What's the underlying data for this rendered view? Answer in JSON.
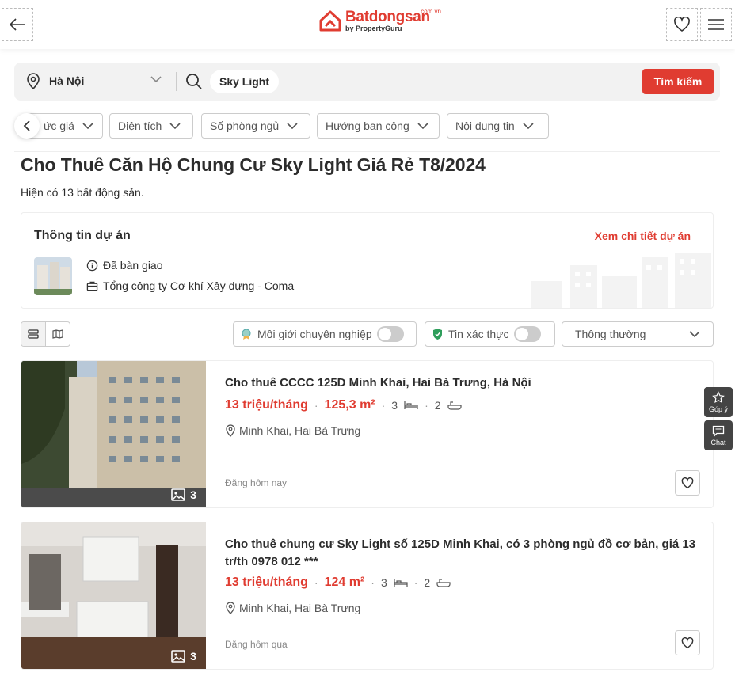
{
  "header": {
    "brand": "Batdongsan",
    "brand_domain": ".com.vn",
    "brand_sub": "by PropertyGuru",
    "brand_color": "#e03c31"
  },
  "search": {
    "location": "Hà Nội",
    "keyword": "Sky Light",
    "button_label": "Tìm kiếm"
  },
  "filters": [
    "ức giá",
    "Diện tích",
    "Số phòng ngủ",
    "Hướng ban công",
    "Nội dung tin"
  ],
  "page": {
    "title": "Cho Thuê Căn Hộ Chung Cư Sky Light Giá Rẻ T8/2024",
    "count_text": "Hiện có 13 bất động sản."
  },
  "project": {
    "heading": "Thông tin dự án",
    "link": "Xem chi tiết dự án",
    "status": "Đã bàn giao",
    "developer": "Tổng công ty Cơ khí Xây dựng - Coma"
  },
  "controls": {
    "pro_broker": "Môi giới chuyên nghiệp",
    "verified": "Tin xác thực",
    "sort": "Thông thường"
  },
  "listings": [
    {
      "title": "Cho thuê CCCC 125D Minh Khai, Hai Bà Trưng, Hà Nội",
      "price": "13 triệu/tháng",
      "area": "125,3 m²",
      "beds": "3",
      "baths": "2",
      "location": "Minh Khai, Hai Bà Trưng",
      "posted": "Đăng hôm nay",
      "images": "3"
    },
    {
      "title": "Cho thuê chung cư Sky Light số 125D Minh Khai, có 3 phòng ngủ đồ cơ bản, giá 13 tr/th 0978 012 ***",
      "price": "13 triệu/tháng",
      "area": "124 m²",
      "beds": "3",
      "baths": "2",
      "location": "Minh Khai, Hai Bà Trưng",
      "posted": "Đăng hôm qua",
      "images": "3"
    }
  ],
  "side": {
    "feedback": "Góp ý",
    "chat": "Chat"
  }
}
